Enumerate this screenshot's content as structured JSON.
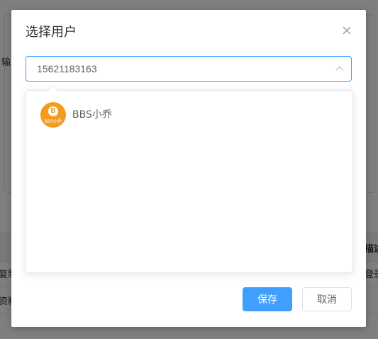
{
  "background": {
    "fragments": [
      "输",
      "描述",
      "复制",
      "登录",
      "资料"
    ]
  },
  "dialog": {
    "title": "选择用户",
    "select": {
      "value": "15621183163"
    },
    "options": [
      {
        "avatar_text": "BBS小乔",
        "avatar_letter": "B",
        "label": "BBS小乔"
      }
    ],
    "buttons": {
      "save": "保存",
      "cancel": "取消"
    }
  },
  "colors": {
    "primary": "#409eff",
    "avatar": "#f39a1f"
  }
}
